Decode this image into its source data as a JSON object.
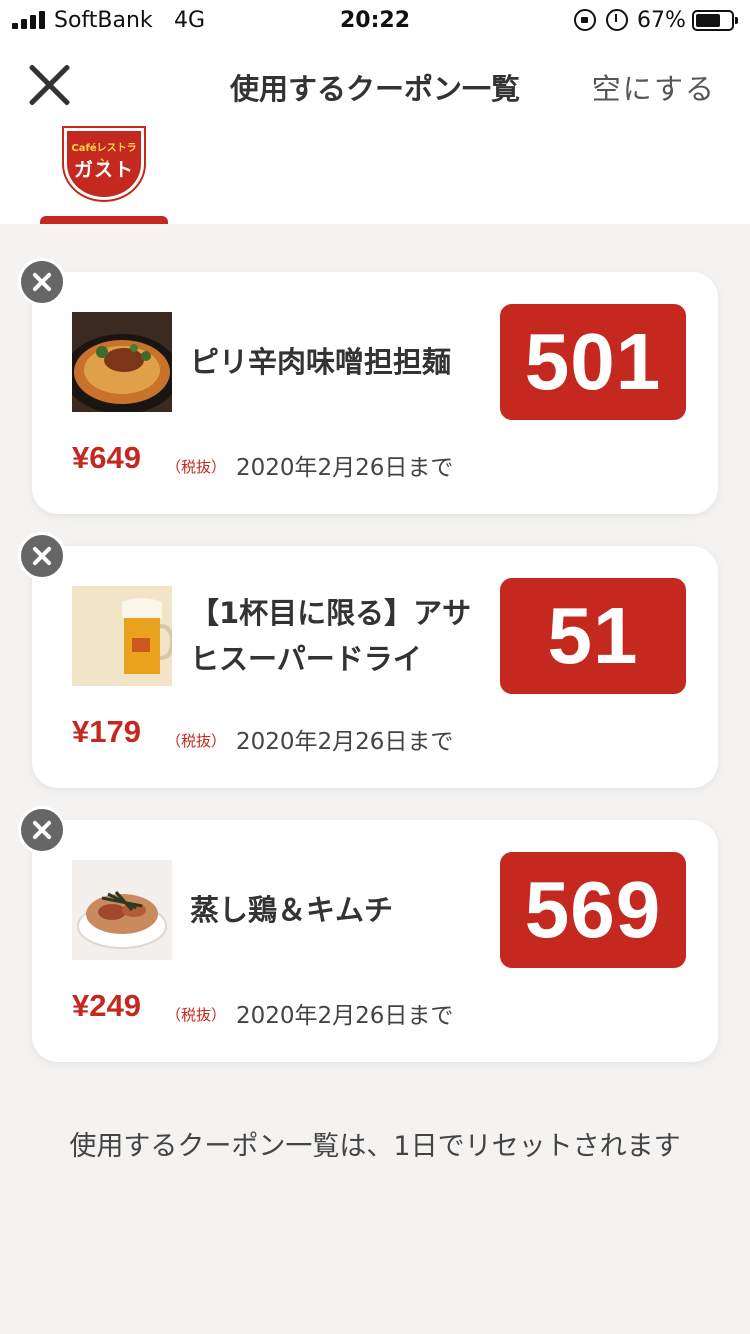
{
  "status_bar": {
    "carrier": "SoftBank",
    "network": "4G",
    "time": "20:22",
    "battery": "67%"
  },
  "header": {
    "title": "使用するクーポン一覧",
    "clear_label": "空にする"
  },
  "brand_tabs": [
    {
      "sub": "Caféレストラン",
      "name": "ガスト",
      "selected": true
    }
  ],
  "coupons": [
    {
      "name": "ピリ辛肉味噌担担麺",
      "code": "501",
      "price": "¥649",
      "tax": "（税抜）",
      "expiry": "2020年2月26日まで",
      "image": "dandan-noodle-photo"
    },
    {
      "name": "【1杯目に限る】アサヒスーパードライ",
      "code": "51",
      "price": "¥179",
      "tax": "（税抜）",
      "expiry": "2020年2月26日まで",
      "image": "beer-mug-photo"
    },
    {
      "name": "蒸し鶏＆キムチ",
      "code": "569",
      "price": "¥249",
      "tax": "（税抜）",
      "expiry": "2020年2月26日まで",
      "image": "chicken-kimchi-photo"
    }
  ],
  "footer_note": "使用するクーポン一覧は、1日でリセットされます",
  "colors": {
    "accent": "#c4281f",
    "background": "#f4f3f2"
  }
}
